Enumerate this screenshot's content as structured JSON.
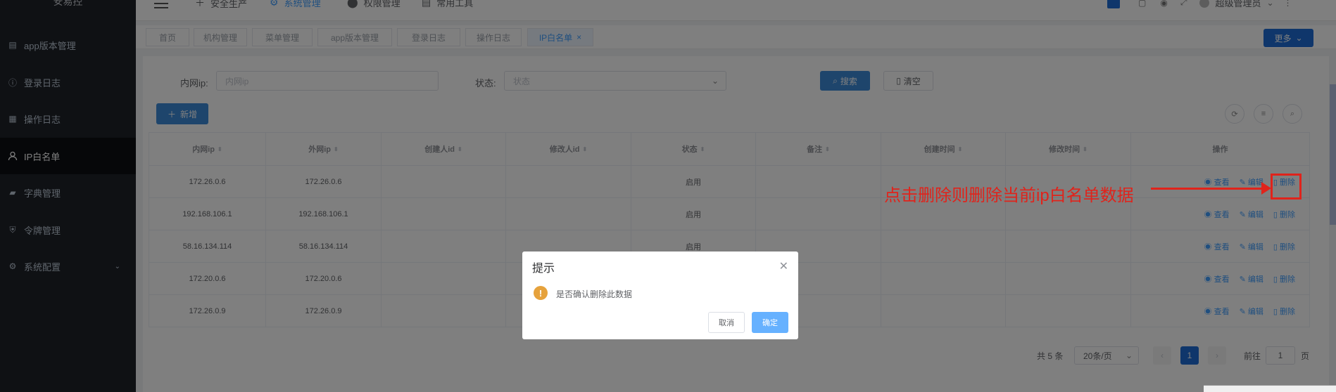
{
  "app": {
    "logo": "安易控"
  },
  "sidebar": {
    "items": [
      {
        "label": "app版本管理",
        "icon": "briefcase-icon"
      },
      {
        "label": "登录日志",
        "icon": "info-icon"
      },
      {
        "label": "操作日志",
        "icon": "clipboard-icon"
      },
      {
        "label": "IP白名单",
        "icon": "user-icon",
        "active": true
      },
      {
        "label": "字典管理",
        "icon": "book-icon"
      },
      {
        "label": "令牌管理",
        "icon": "shield-icon"
      },
      {
        "label": "系统配置",
        "icon": "gear-icon"
      }
    ]
  },
  "navbar": {
    "items": [
      "安全生产",
      "系统管理",
      "权限管理",
      "常用工具"
    ],
    "user": "超级管理员"
  },
  "tags": {
    "items": [
      "首页",
      "机构管理",
      "菜单管理",
      "app版本管理",
      "登录日志",
      "操作日志",
      "IP白名单"
    ],
    "close": "×",
    "more": "更多"
  },
  "search": {
    "ip_label": "内网ip:",
    "ip_placeholder": "内网ip",
    "status_label": "状态:",
    "status_placeholder": "状态",
    "search_btn": "搜索",
    "clear_btn": "清空",
    "add_btn": "新增"
  },
  "table": {
    "headers": [
      "内网ip",
      "外网ip",
      "创建人id",
      "修改人id",
      "状态",
      "备注",
      "创建时间",
      "修改时间",
      "操作"
    ],
    "rows": [
      {
        "inner": "172.26.0.6",
        "outer": "172.26.0.6",
        "status": "启用"
      },
      {
        "inner": "192.168.106.1",
        "outer": "192.168.106.1",
        "status": "启用"
      },
      {
        "inner": "58.16.134.114",
        "outer": "58.16.134.114",
        "status": "启用"
      },
      {
        "inner": "172.20.0.6",
        "outer": "172.20.0.6",
        "status": ""
      },
      {
        "inner": "172.26.0.9",
        "outer": "172.26.0.9",
        "status": ""
      }
    ],
    "ops": {
      "view": "查看",
      "edit": "编辑",
      "delete": "删除"
    }
  },
  "pagination": {
    "total": "共 5 条",
    "page_size": "20条/页",
    "current": "1",
    "goto_label": "前往",
    "goto_value": "1",
    "page_suffix": "页"
  },
  "dialog": {
    "title": "提示",
    "message": "是否确认删除此数据",
    "cancel": "取消",
    "confirm": "确定"
  },
  "annotation": {
    "text": "点击删除则删除当前ip白名单数据",
    "color": "#e0231b"
  }
}
